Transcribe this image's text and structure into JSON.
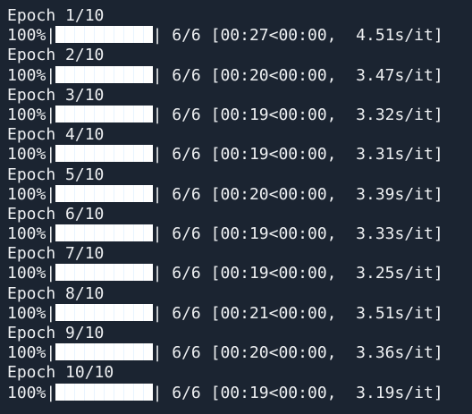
{
  "epochs": [
    {
      "label": "Epoch 1/10",
      "percent": "100%",
      "progress": 1.0,
      "count": "6/6",
      "stats": "[00:27<00:00,  4.51s/it]"
    },
    {
      "label": "Epoch 2/10",
      "percent": "100%",
      "progress": 1.0,
      "count": "6/6",
      "stats": "[00:20<00:00,  3.47s/it]"
    },
    {
      "label": "Epoch 3/10",
      "percent": "100%",
      "progress": 1.0,
      "count": "6/6",
      "stats": "[00:19<00:00,  3.32s/it]"
    },
    {
      "label": "Epoch 4/10",
      "percent": "100%",
      "progress": 1.0,
      "count": "6/6",
      "stats": "[00:19<00:00,  3.31s/it]"
    },
    {
      "label": "Epoch 5/10",
      "percent": "100%",
      "progress": 1.0,
      "count": "6/6",
      "stats": "[00:20<00:00,  3.39s/it]"
    },
    {
      "label": "Epoch 6/10",
      "percent": "100%",
      "progress": 1.0,
      "count": "6/6",
      "stats": "[00:19<00:00,  3.33s/it]"
    },
    {
      "label": "Epoch 7/10",
      "percent": "100%",
      "progress": 1.0,
      "count": "6/6",
      "stats": "[00:19<00:00,  3.25s/it]"
    },
    {
      "label": "Epoch 8/10",
      "percent": "100%",
      "progress": 1.0,
      "count": "6/6",
      "stats": "[00:21<00:00,  3.51s/it]"
    },
    {
      "label": "Epoch 9/10",
      "percent": "100%",
      "progress": 1.0,
      "count": "6/6",
      "stats": "[00:20<00:00,  3.36s/it]"
    },
    {
      "label": "Epoch 10/10",
      "percent": "100%",
      "progress": 1.0,
      "count": "6/6",
      "stats": "[00:19<00:00,  3.19s/it]"
    }
  ]
}
